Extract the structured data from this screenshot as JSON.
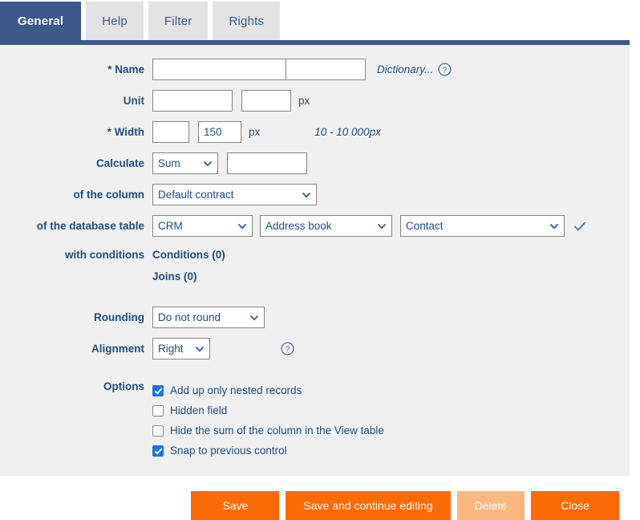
{
  "tabs": [
    {
      "label": "General",
      "active": true
    },
    {
      "label": "Help",
      "active": false
    },
    {
      "label": "Filter",
      "active": false
    },
    {
      "label": "Rights",
      "active": false
    }
  ],
  "form": {
    "name": {
      "label": "* Name",
      "value_primary": "",
      "value_secondary": "",
      "dictionary_link": "Dictionary...",
      "help_icon": "question-mark-circle-icon"
    },
    "unit": {
      "label": "Unit",
      "value_primary": "",
      "value_secondary": "",
      "suffix": "px"
    },
    "width": {
      "label": "* Width",
      "value_primary": "",
      "value_secondary": "150",
      "suffix": "px",
      "hint": "10 - 10 000px"
    },
    "calculate": {
      "label": "Calculate",
      "selected": "Sum",
      "extra_value": ""
    },
    "of_the_column": {
      "label": "of the column",
      "selected": "Default contract"
    },
    "of_the_database_table": {
      "label": "of the database table",
      "selected_1": "CRM",
      "selected_2": "Address book",
      "selected_3": "Contact",
      "confirm_icon": "checkmark-icon"
    },
    "with_conditions": {
      "label": "with conditions",
      "conditions_link": "Conditions (0)",
      "joins_link": "Joins (0)"
    },
    "rounding": {
      "label": "Rounding",
      "selected": "Do not round"
    },
    "alignment": {
      "label": "Alignment",
      "selected": "Right",
      "help_icon": "question-mark-circle-icon"
    },
    "options": {
      "label": "Options",
      "items": [
        {
          "label": "Add up only nested records",
          "checked": true
        },
        {
          "label": "Hidden field",
          "checked": false
        },
        {
          "label": "Hide the sum of the column in the View table",
          "checked": false
        },
        {
          "label": "Snap to previous control",
          "checked": true
        }
      ]
    }
  },
  "footer": {
    "buttons": [
      {
        "label": "Save",
        "state": "enabled"
      },
      {
        "label": "Save and continue editing",
        "state": "enabled"
      },
      {
        "label": "Delete",
        "state": "disabled"
      },
      {
        "label": "Close",
        "state": "enabled"
      }
    ]
  },
  "colors": {
    "accent_blue": "#3b5a8a",
    "text_blue": "#1f4e79",
    "button_orange": "#fc6a06",
    "button_orange_disabled": "#fcb67f",
    "panel_bg": "#f0f0f0",
    "tab_inactive_bg": "#e3e3e3",
    "checkbox_checked": "#1a73e8"
  }
}
